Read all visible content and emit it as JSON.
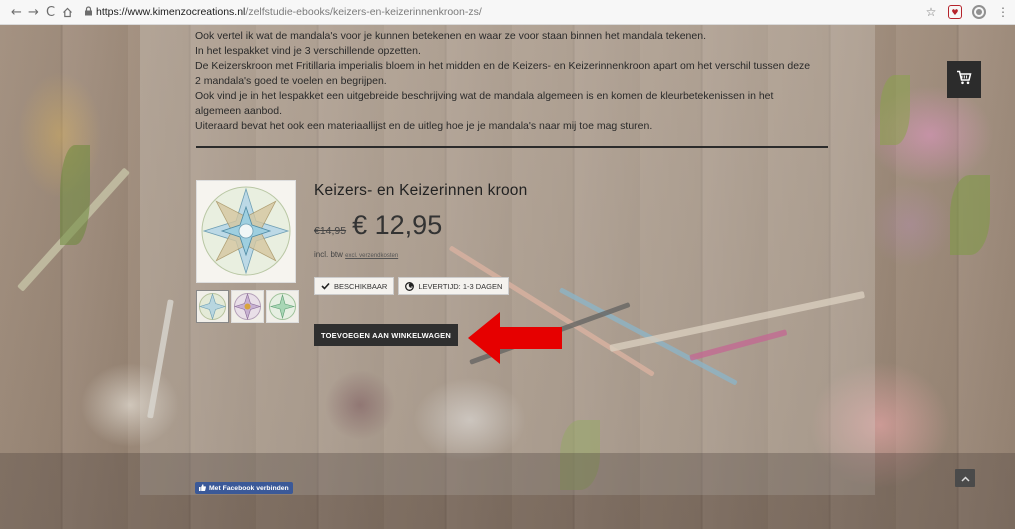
{
  "browser": {
    "url_host": "https://www.kimenzocreations.nl",
    "url_path": "/zelfstudie-ebooks/keizers-en-keizerinnenkroon-zs/"
  },
  "intro": {
    "lines": [
      "Ook vertel ik wat de mandala's voor je kunnen betekenen en waar ze voor staan binnen het mandala tekenen.",
      "In het lespakket vind je 3 verschillende opzetten.",
      "De Keizerskroon met Fritillaria imperialis bloem in het midden en de Keizers- en Keizerinnenkroon apart om het verschil tussen deze",
      "2 mandala's goed te voelen en begrijpen.",
      "Ook vind je in het lespakket een uitgebreide beschrijving wat de mandala algemeen is en komen de kleurbetekenissen in het",
      "algemeen aanbod.",
      "Uiteraard bevat het ook een materiaallijst en de uitleg hoe je je mandala's naar mij toe mag sturen."
    ]
  },
  "product": {
    "title": "Keizers- en Keizerinnen kroon",
    "old_price": "€14,95",
    "price": "€ 12,95",
    "tax_label": "incl. btw",
    "shipping_link": "excl. verzendkosten",
    "badge_available": "BESCHIKBAAR",
    "badge_delivery": "LEVERTIJD: 1-3 DAGEN",
    "add_to_cart": "TOEVOEGEN AAN WINKELWAGEN"
  },
  "footer": {
    "facebook_connect": "Met Facebook verbinden"
  },
  "colors": {
    "annotation_arrow": "#e60000",
    "button_dark": "#2f2f2f",
    "facebook": "#3b5998"
  },
  "icons": [
    "back-icon",
    "forward-icon",
    "reload-icon",
    "home-icon",
    "lock-icon",
    "star-icon",
    "shopping-cart-icon",
    "checkmark-icon",
    "clock-icon",
    "chevron-up-icon",
    "facebook-like-icon"
  ]
}
